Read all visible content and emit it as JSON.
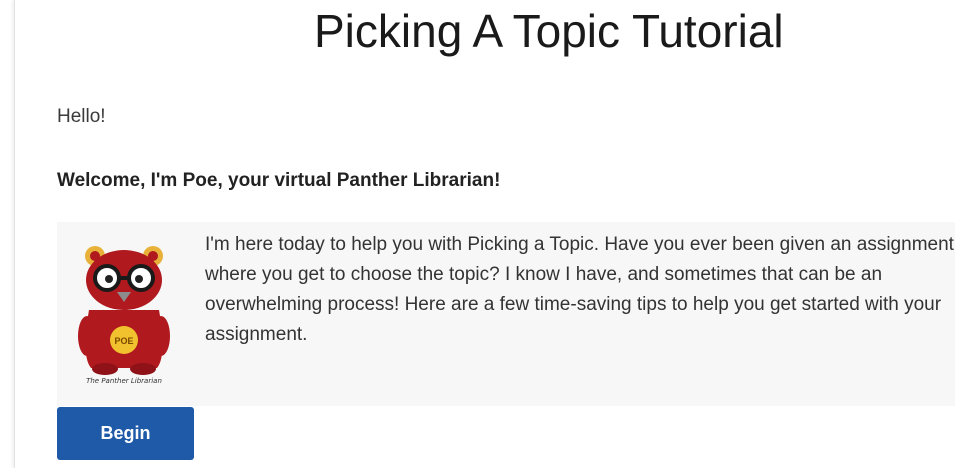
{
  "page": {
    "title": "Picking A Topic Tutorial"
  },
  "greeting": "Hello!",
  "welcome": "Welcome, I'm Poe, your virtual Panther Librarian!",
  "intro": {
    "text": "I'm here today to help you with Picking a Topic. Have you ever been given an assignment where you get to choose the topic? I know I have, and sometimes that can be an overwhelming process! Here are a few time-saving tips to help you get started with your assignment.",
    "avatar": {
      "icon": "panther-librarian-mascot",
      "badge_text": "POE",
      "caption": "The Panther Librarian"
    }
  },
  "actions": {
    "begin_label": "Begin"
  },
  "colors": {
    "button": "#1e5aa8",
    "mascot_red": "#b0191e",
    "mascot_badge": "#f2c12e"
  }
}
